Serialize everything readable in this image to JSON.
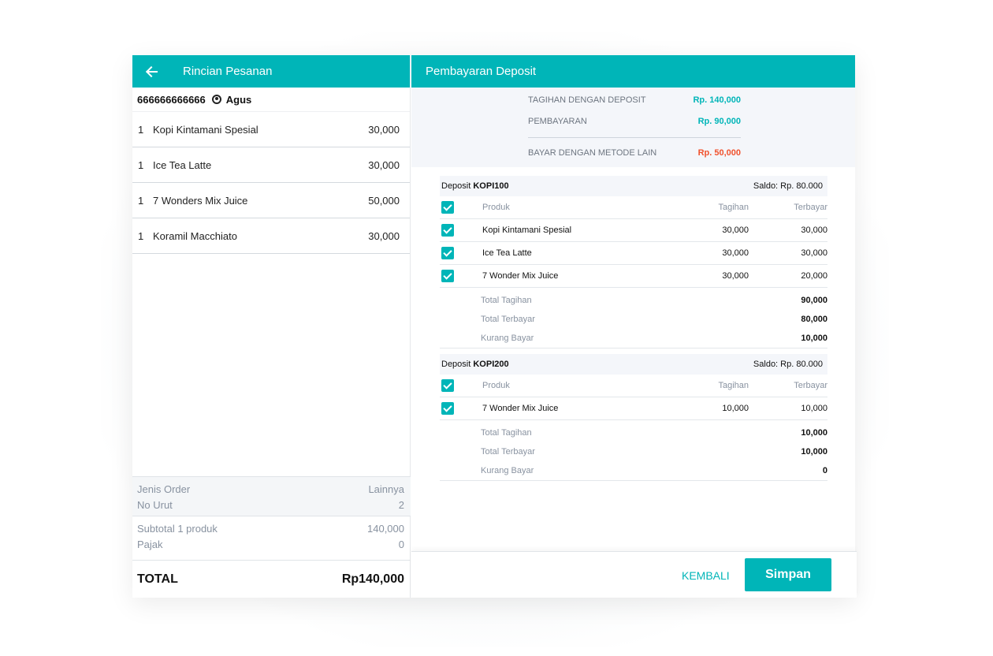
{
  "left": {
    "title": "Rincian Pesanan",
    "customer_id": "666666666666",
    "customer_name": "Agus",
    "items": [
      {
        "qty": "1",
        "name": "Kopi Kintamani Spesial",
        "price": "30,000"
      },
      {
        "qty": "1",
        "name": "Ice Tea Latte",
        "price": "30,000"
      },
      {
        "qty": "1",
        "name": "7 Wonders Mix Juice",
        "price": "50,000"
      },
      {
        "qty": "1",
        "name": "Koramil Macchiato",
        "price": "30,000"
      }
    ],
    "jenis_order_label": "Jenis Order",
    "jenis_order_value": "Lainnya",
    "no_urut_label": "No Urut",
    "no_urut_value": "2",
    "subtotal_label": "Subtotal 1 produk",
    "subtotal_value": "140,000",
    "pajak_label": "Pajak",
    "pajak_value": "0",
    "total_label": "TOTAL",
    "total_value": "Rp140,000"
  },
  "right": {
    "title": "Pembayaran Deposit",
    "summary": {
      "tagihan_label": "TAGIHAN DENGAN DEPOSIT",
      "tagihan_value": "Rp. 140,000",
      "pembayaran_label": "PEMBAYARAN",
      "pembayaran_value": "Rp. 90,000",
      "lain_label": "BAYAR DENGAN METODE LAIN",
      "lain_value": "Rp. 50,000"
    },
    "headers": {
      "produk": "Produk",
      "tagihan": "Tagihan",
      "terbayar": "Terbayar"
    },
    "totals_labels": {
      "total_tagihan": "Total Tagihan",
      "total_terbayar": "Total Terbayar",
      "kurang_bayar": "Kurang Bayar"
    },
    "deposit_prefix": "Deposit",
    "deposits": [
      {
        "code": "KOPI100",
        "saldo": "Saldo: Rp. 80.000",
        "rows": [
          {
            "produk": "Kopi Kintamani Spesial",
            "tagihan": "30,000",
            "terbayar": "30,000"
          },
          {
            "produk": "Ice Tea Latte",
            "tagihan": "30,000",
            "terbayar": "30,000"
          },
          {
            "produk": "7 Wonder Mix Juice",
            "tagihan": "30,000",
            "terbayar": "20,000"
          }
        ],
        "total_tagihan": "90,000",
        "total_terbayar": "80,000",
        "kurang_bayar": "10,000"
      },
      {
        "code": "KOPI200",
        "saldo": "Saldo: Rp. 80.000",
        "rows": [
          {
            "produk": "7 Wonder Mix Juice",
            "tagihan": "10,000",
            "terbayar": "10,000"
          }
        ],
        "total_tagihan": "10,000",
        "total_terbayar": "10,000",
        "kurang_bayar": "0"
      }
    ],
    "back_label": "KEMBALI",
    "save_label": "Simpan"
  },
  "colors": {
    "accent": "#00b5b8",
    "value_teal": "#00b5b8",
    "value_red": "#f0522d"
  }
}
